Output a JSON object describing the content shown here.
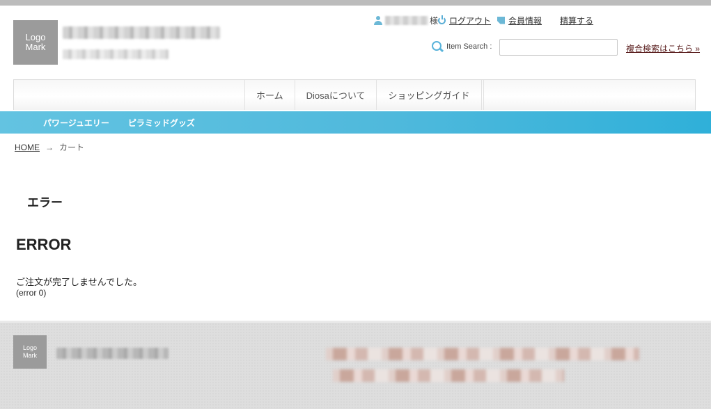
{
  "header": {
    "logo_text": "Logo Mark",
    "user": {
      "suffix": "様"
    },
    "links": {
      "logout": "ログアウト",
      "member_info": "会員情報",
      "checkout": "精算する"
    },
    "search": {
      "label": "Item Search :",
      "value": "",
      "advanced_link": "複合検索はこちら »"
    }
  },
  "main_nav": {
    "tabs": [
      {
        "label": "ホーム"
      },
      {
        "label": "Diosaについて"
      },
      {
        "label": "ショッピングガイド"
      }
    ]
  },
  "category_bar": {
    "items": [
      {
        "label": "パワージュエリー"
      },
      {
        "label": "ピラミッドグッズ"
      }
    ]
  },
  "breadcrumb": {
    "home": "HOME",
    "separator": "→",
    "current": "カート"
  },
  "content": {
    "page_heading": "エラー",
    "error_title": "ERROR",
    "error_message": "ご注文が完了しませんでした。",
    "error_code": "(error 0)"
  },
  "footer": {
    "logo_text": "Logo Mark"
  },
  "colors": {
    "category_bar": "#4fb9dc",
    "icon_accent": "#5aaed6",
    "logo_box": "#9b9b9b",
    "footer_bg": "#dedede"
  }
}
